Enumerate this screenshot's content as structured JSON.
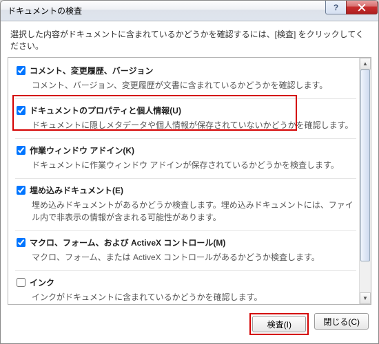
{
  "title": "ドキュメントの検査",
  "instruction": "選択した内容がドキュメントに含まれているかどうかを確認するには、[検査] をクリックしてください。",
  "items": [
    {
      "checked": true,
      "label": "コメント、変更履歴、バージョン",
      "desc": "コメント、バージョン、変更履歴が文書に含まれているかどうかを確認します。"
    },
    {
      "checked": true,
      "label": "ドキュメントのプロパティと個人情報(U)",
      "desc": "ドキュメントに隠しメタデータや個人情報が保存されていないかどうかを確認します。"
    },
    {
      "checked": true,
      "label": "作業ウィンドウ アドイン(K)",
      "desc": "ドキュメントに作業ウィンドウ アドインが保存されているかどうかを検査します。"
    },
    {
      "checked": true,
      "label": "埋め込みドキュメント(E)",
      "desc": "埋め込みドキュメントがあるかどうか検査します。埋め込みドキュメントには、ファイル内で非表示の情報が含まれる可能性があります。"
    },
    {
      "checked": true,
      "label": "マクロ、フォーム、および ActiveX コントロール(M)",
      "desc": "マクロ、フォーム、または ActiveX コントロールがあるかどうか検査します。"
    },
    {
      "checked": false,
      "label": "インク",
      "desc": "インクがドキュメントに含まれているかどうかを確認します。"
    }
  ],
  "buttons": {
    "inspect": "検査(I)",
    "close": "閉じる(C)"
  },
  "helpGlyph": "?"
}
